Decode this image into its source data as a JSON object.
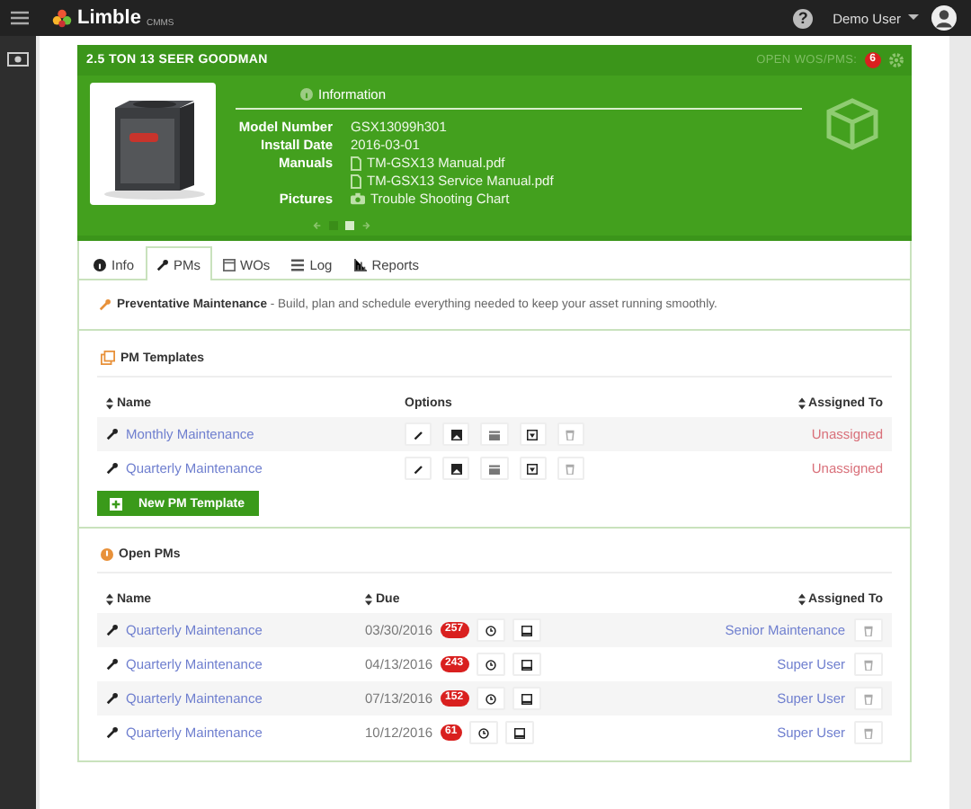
{
  "topbar": {
    "logo": "Limble",
    "logo_suffix": "CMMS",
    "help": "?",
    "user": "Demo User"
  },
  "asset": {
    "title": "2.5 TON 13 SEER GOODMAN",
    "open_label": "OPEN WOS/PMS:",
    "open_count": "6",
    "info_title": "Information",
    "fields": [
      {
        "label": "Model Number",
        "values": [
          {
            "kind": "text",
            "text": "GSX13099h301"
          }
        ]
      },
      {
        "label": "Install Date",
        "values": [
          {
            "kind": "text",
            "text": "2016-03-01"
          }
        ]
      },
      {
        "label": "Manuals",
        "values": [
          {
            "kind": "file",
            "text": "TM-GSX13 Manual.pdf"
          },
          {
            "kind": "file",
            "text": "TM-GSX13 Service Manual.pdf"
          }
        ]
      },
      {
        "label": "Pictures",
        "values": [
          {
            "text": "Trouble Shooting Chart"
          }
        ]
      }
    ],
    "slides": [
      {
        "selected": false
      },
      {
        "selected": true
      }
    ]
  },
  "tabs": [
    {
      "kind": "info",
      "label": "Info",
      "selected": false
    },
    {
      "kind": "wrench",
      "label": "PMs",
      "selected": true
    },
    {
      "kind": "calendar",
      "label": "WOs",
      "selected": false
    },
    {
      "kind": "list",
      "label": "Log",
      "selected": false
    },
    {
      "kind": "chart",
      "label": "Reports",
      "selected": false
    }
  ],
  "description": "**Preventative Maintenance** - Build, plan and schedule everything needed to keep your asset running smoothly.",
  "templates": {
    "title": "PM Templates",
    "columns": [
      "Name",
      "Options",
      "Assigned To"
    ],
    "rows": [
      {
        "name": "Monthly Maintenance",
        "assigned": "Unassigned"
      },
      {
        "name": "Quarterly Maintenance",
        "assigned": "Unassigned"
      }
    ],
    "button": "New PM Template"
  },
  "open_pms": {
    "title": "Open PMs",
    "columns": [
      "Name",
      "Due",
      "Assigned To"
    ],
    "rows": [
      {
        "name": "Quarterly Maintenance",
        "due": "03/30/2016",
        "days": "257",
        "assigned": "Senior Maintenance"
      },
      {
        "name": "Quarterly Maintenance",
        "due": "04/13/2016",
        "days": "243",
        "assigned": "Super User"
      },
      {
        "name": "Quarterly Maintenance",
        "due": "07/13/2016",
        "days": "152",
        "assigned": "Super User"
      },
      {
        "name": "Quarterly Maintenance",
        "due": "10/12/2016",
        "days": "61",
        "assigned": "Super User"
      }
    ]
  }
}
